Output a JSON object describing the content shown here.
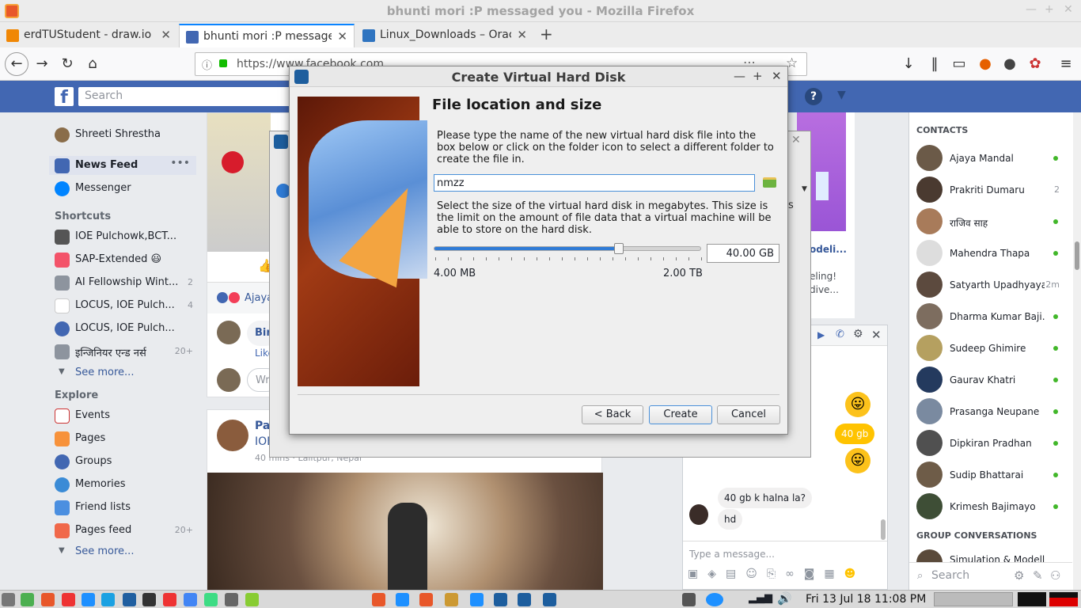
{
  "window": {
    "title": "bhunti mori :P messaged you - Mozilla Firefox"
  },
  "tabs": [
    {
      "label": "erdTUStudent - draw.io",
      "color": "#f08705"
    },
    {
      "label": "bhunti mori :P messaged you",
      "color": "#4267b2"
    },
    {
      "label": "Linux_Downloads – Oracle",
      "color": "#2f74c0"
    }
  ],
  "url": "https://www.facebook.com",
  "facebook": {
    "search_placeholder": "Search",
    "help": "?",
    "user": "Shreeti Shrestha",
    "nav": [
      {
        "label": "News Feed"
      },
      {
        "label": "Messenger"
      }
    ],
    "shortcuts_heading": "Shortcuts",
    "shortcuts": [
      {
        "label": "IOE Pulchowk,BCT...",
        "count": ""
      },
      {
        "label": "SAP-Extended 😃",
        "count": ""
      },
      {
        "label": "AI Fellowship Wint...",
        "count": "2"
      },
      {
        "label": "LOCUS, IOE Pulch...",
        "count": "4"
      },
      {
        "label": "LOCUS, IOE Pulch...",
        "count": ""
      },
      {
        "label": "इन्जिनियर एन्ड नर्स",
        "count": "20+"
      }
    ],
    "see_more": "See more...",
    "explore_heading": "Explore",
    "explore": [
      {
        "label": "Events",
        "count": ""
      },
      {
        "label": "Pages",
        "count": ""
      },
      {
        "label": "Groups",
        "count": ""
      },
      {
        "label": "Memories",
        "count": ""
      },
      {
        "label": "Friend lists",
        "count": ""
      },
      {
        "label": "Pages feed",
        "count": "20+"
      }
    ],
    "see_more2": "See more...",
    "feed": {
      "reaction_name": "Ajaya",
      "commenter": "Bir",
      "like": "Like",
      "write": "Wri",
      "post_author": "Pav",
      "post_group": "IOE",
      "post_meta": "40 mins · Lalitpur, Nepal"
    },
    "right": {
      "title": "odeli...",
      "text1": "eling!",
      "text2": "dive...",
      "trailing": "s"
    }
  },
  "contacts": {
    "heading": "CONTACTS",
    "list": [
      {
        "name": "Ajaya Mandal",
        "status": "online"
      },
      {
        "name": "Prakriti Dumaru",
        "status": "2"
      },
      {
        "name": "राजिव साह",
        "status": "online"
      },
      {
        "name": "Mahendra Thapa",
        "status": "online"
      },
      {
        "name": "Satyarth Upadhyaya",
        "status": "2m"
      },
      {
        "name": "Dharma Kumar Baji...",
        "status": "online"
      },
      {
        "name": "Sudeep Ghimire",
        "status": "online"
      },
      {
        "name": "Gaurav Khatri",
        "status": "online"
      },
      {
        "name": "Prasanga Neupane",
        "status": "online"
      },
      {
        "name": "Dipkiran Pradhan",
        "status": "online"
      },
      {
        "name": "Sudip Bhattarai",
        "status": "online"
      },
      {
        "name": "Krimesh Bajimayo",
        "status": "online"
      }
    ],
    "group_heading": "GROUP CONVERSATIONS",
    "group": "Simulation & Modelling",
    "search": "Search"
  },
  "chat": {
    "sent": "40 gb",
    "recv1": "40 gb k halna la?",
    "recv2": "hd",
    "input_placeholder": "Type a message..."
  },
  "dialog": {
    "title": "Create Virtual Hard Disk",
    "heading": "File location and size",
    "desc1": "Please type the name of the new virtual hard disk file into the box below or click on the folder icon to select a different folder to create the file in.",
    "filename": "nmzz",
    "desc2": "Select the size of the virtual hard disk in megabytes. This size is the limit on the amount of file data that a virtual machine will be able to store on the hard disk.",
    "size_value": "40.00 GB",
    "size_fraction": 0.69,
    "min_label": "4.00 MB",
    "max_label": "2.00 TB",
    "back": "< Back",
    "create": "Create",
    "cancel": "Cancel"
  },
  "taskbar": {
    "clock": "Fri 13 Jul 18  11:08 PM"
  }
}
